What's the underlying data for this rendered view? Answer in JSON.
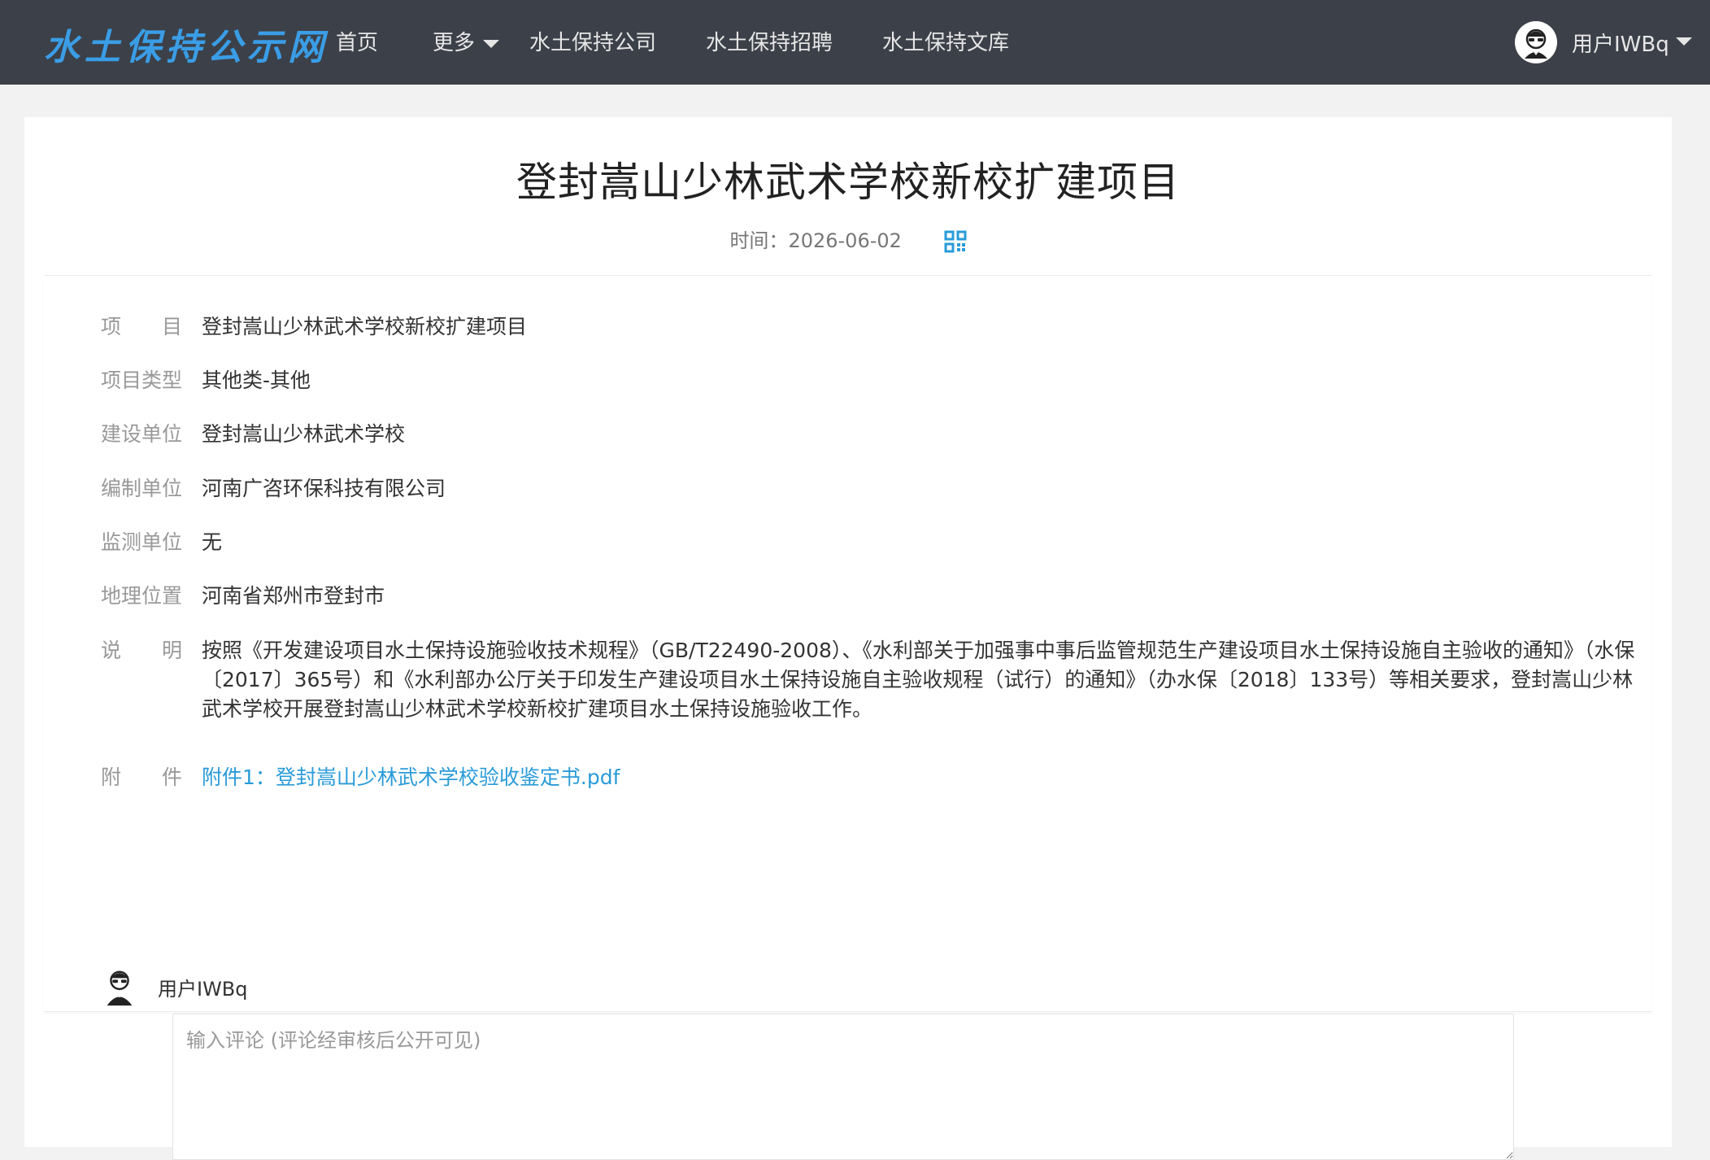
{
  "nav": {
    "logo": "水土保持公示网",
    "items": [
      "首页",
      "更多",
      "水土保持公司",
      "水土保持招聘",
      "水土保持文库"
    ],
    "user": "用户IWBq"
  },
  "article": {
    "title": "登封嵩山少林武术学校新校扩建项目",
    "time_label": "时间：",
    "time": "2026-06-02",
    "fields": [
      {
        "label": "项目",
        "value": "登封嵩山少林武术学校新校扩建项目"
      },
      {
        "label": "项目类型",
        "value": "其他类-其他"
      },
      {
        "label": "建设单位",
        "value": "登封嵩山少林武术学校"
      },
      {
        "label": "编制单位",
        "value": "河南广咨环保科技有限公司"
      },
      {
        "label": "监测单位",
        "value": "无"
      },
      {
        "label": "地理位置",
        "value": "河南省郑州市登封市"
      }
    ],
    "desc_label": "说明",
    "desc": "按照《开发建设项目水土保持设施验收技术规程》（GB/T22490-2008）、《水利部关于加强事中事后监管规范生产建设项目水土保持设施自主验收的通知》（水保〔2017〕365号）和《水利部办公厅关于印发生产建设项目水土保持设施自主验收规程（试行）的通知》（办水保〔2018〕133号）等相关要求，登封嵩山少林武术学校开展登封嵩山少林武术学校新校扩建项目水土保持设施验收工作。",
    "attach_label": "附件",
    "attachment": "附件1：登封嵩山少林武术学校验收鉴定书.pdf"
  },
  "comment": {
    "user": "用户IWBq",
    "placeholder": "输入评论 (评论经审核后公开可见)"
  },
  "colors": {
    "nav_bg": "#3c4048",
    "logo": "#3a9de6",
    "link": "#2a9bd8"
  },
  "icons": [
    "avatar-icon",
    "chevron-down-icon",
    "qrcode-icon"
  ]
}
